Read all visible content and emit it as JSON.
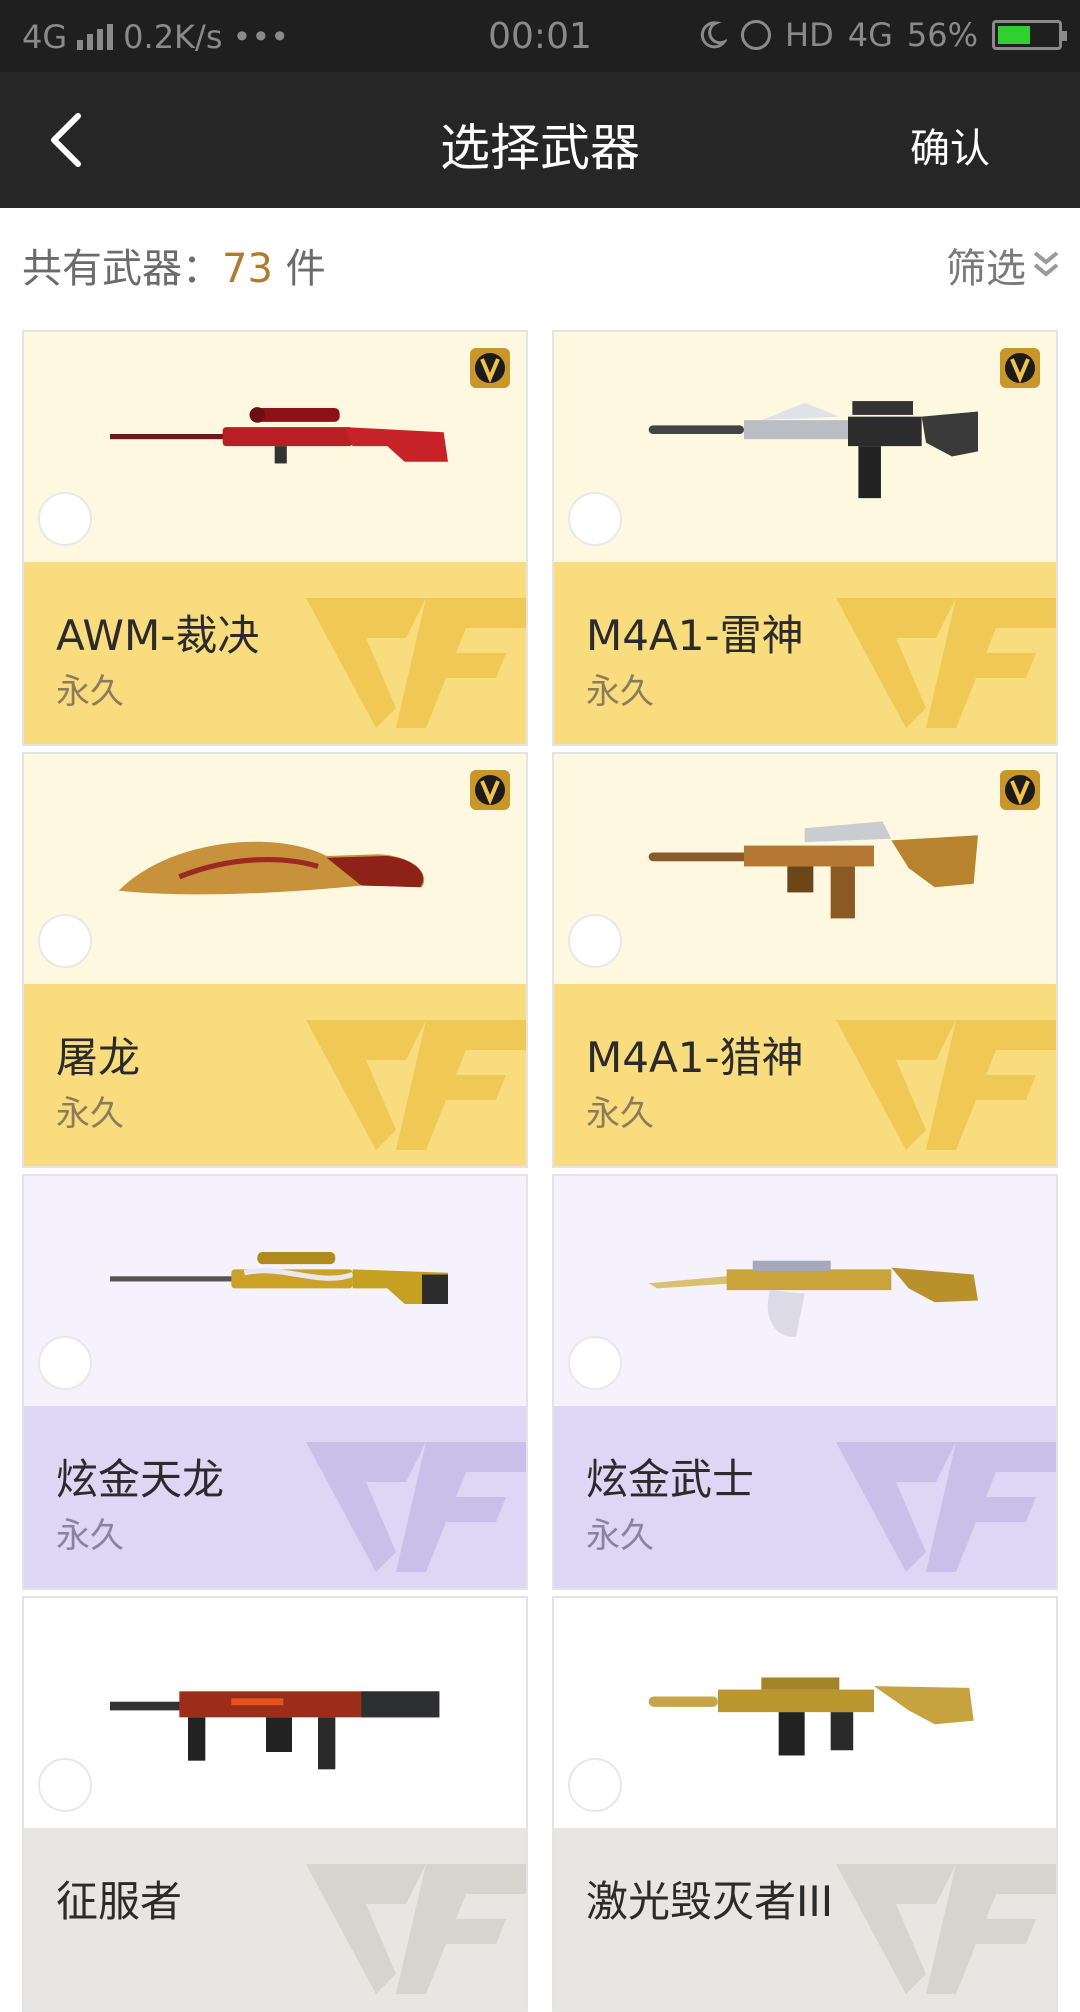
{
  "status_bar": {
    "network": "4G",
    "speed": "0.2K/s",
    "more": "•••",
    "time": "00:01",
    "hd": "HD",
    "net_right": "4G",
    "battery_percent": "56%",
    "battery_level": 0.56
  },
  "header": {
    "title": "选择武器",
    "confirm_label": "确认"
  },
  "summary": {
    "label": "共有武器：",
    "count": "73",
    "unit": " 件"
  },
  "filter": {
    "label": "筛选"
  },
  "colors": {
    "gold_bottom": "#f8dc7e",
    "purple_bottom": "#ddd6f4",
    "count_accent": "#b07a2f"
  },
  "weapons": [
    {
      "name": "AWM-裁决",
      "duration": "永久",
      "tier": "gold",
      "vip": true,
      "selected": false,
      "icon": "sniper-rifle-red-icon"
    },
    {
      "name": "M4A1-雷神",
      "duration": "永久",
      "tier": "gold",
      "vip": true,
      "selected": false,
      "icon": "assault-rifle-silver-icon"
    },
    {
      "name": "屠龙",
      "duration": "永久",
      "tier": "gold",
      "vip": true,
      "selected": false,
      "icon": "dragon-knife-icon"
    },
    {
      "name": "M4A1-猎神",
      "duration": "永久",
      "tier": "gold",
      "vip": true,
      "selected": false,
      "icon": "assault-rifle-bronze-icon"
    },
    {
      "name": "炫金天龙",
      "duration": "永久",
      "tier": "purple",
      "vip": false,
      "selected": false,
      "icon": "sniper-rifle-gold-icon"
    },
    {
      "name": "炫金武士",
      "duration": "永久",
      "tier": "purple",
      "vip": false,
      "selected": false,
      "icon": "ak-rifle-gold-icon"
    },
    {
      "name": "征服者",
      "duration": "",
      "tier": "gray",
      "vip": false,
      "selected": false,
      "icon": "shotgun-red-icon"
    },
    {
      "name": "激光毁灭者III",
      "duration": "",
      "tier": "gray",
      "vip": false,
      "selected": false,
      "icon": "assault-rifle-gold-icon"
    }
  ]
}
